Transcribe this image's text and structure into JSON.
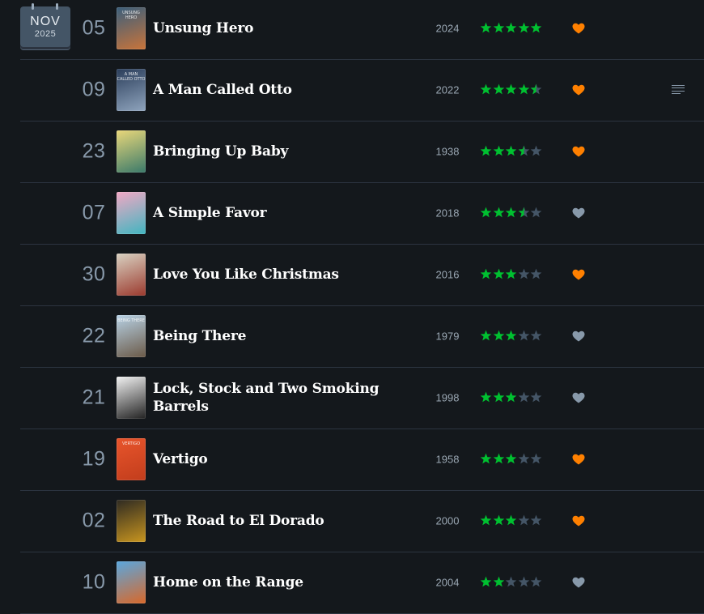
{
  "month_badge": {
    "month": "NOV",
    "year": "2025"
  },
  "colors": {
    "star_on": "#00c030",
    "star_off": "#445566",
    "heart_liked": "#ff8000",
    "heart_unliked": "#8899aa"
  },
  "entries": [
    {
      "day": "05",
      "title": "Unsung Hero",
      "year": "2024",
      "rating": 5,
      "liked": true,
      "review": false,
      "poster_colors": [
        "#3b5f7c",
        "#c9743a"
      ],
      "poster_text": "UNSUNG HERO"
    },
    {
      "day": "09",
      "title": "A Man Called Otto",
      "year": "2022",
      "rating": 4.5,
      "liked": true,
      "review": true,
      "poster_colors": [
        "#2a3d5a",
        "#8fa4bd"
      ],
      "poster_text": "A MAN CALLED OTTO"
    },
    {
      "day": "23",
      "title": "Bringing Up Baby",
      "year": "1938",
      "rating": 3.5,
      "liked": true,
      "review": false,
      "poster_colors": [
        "#e9d77a",
        "#3b7a6a"
      ],
      "poster_text": ""
    },
    {
      "day": "07",
      "title": "A Simple Favor",
      "year": "2018",
      "rating": 3.5,
      "liked": false,
      "review": false,
      "poster_colors": [
        "#f2a8c4",
        "#41b5c0"
      ],
      "poster_text": ""
    },
    {
      "day": "30",
      "title": "Love You Like Christmas",
      "year": "2016",
      "rating": 3,
      "liked": true,
      "review": false,
      "poster_colors": [
        "#d9d2c2",
        "#9b3a2e"
      ],
      "poster_text": ""
    },
    {
      "day": "22",
      "title": "Being There",
      "year": "1979",
      "rating": 3,
      "liked": false,
      "review": false,
      "poster_colors": [
        "#b8d2e6",
        "#6b5a48"
      ],
      "poster_text": "BEING THERE"
    },
    {
      "day": "21",
      "title": "Lock, Stock and Two Smoking Barrels",
      "year": "1998",
      "rating": 3,
      "liked": false,
      "review": false,
      "poster_colors": [
        "#f2f2f2",
        "#222222"
      ],
      "poster_text": ""
    },
    {
      "day": "19",
      "title": "Vertigo",
      "year": "1958",
      "rating": 3,
      "liked": true,
      "review": false,
      "poster_colors": [
        "#e8552c",
        "#c23d1c"
      ],
      "poster_text": "VERTIGO"
    },
    {
      "day": "02",
      "title": "The Road to El Dorado",
      "year": "2000",
      "rating": 3,
      "liked": true,
      "review": false,
      "poster_colors": [
        "#2e2a22",
        "#c8951f"
      ],
      "poster_text": ""
    },
    {
      "day": "10",
      "title": "Home on the Range",
      "year": "2004",
      "rating": 2,
      "liked": false,
      "review": false,
      "poster_colors": [
        "#5aa7de",
        "#d8682a"
      ],
      "poster_text": ""
    }
  ]
}
